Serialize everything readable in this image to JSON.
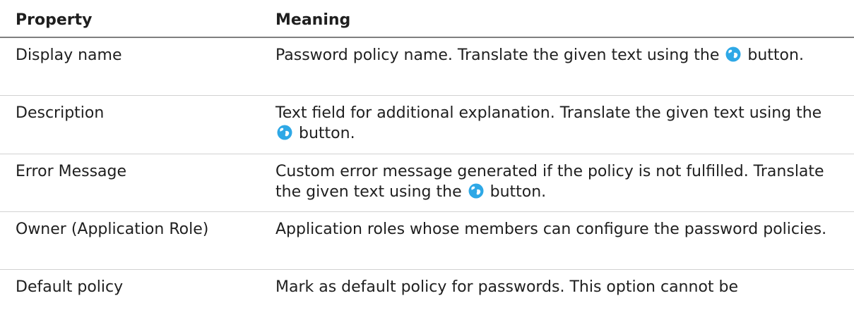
{
  "table": {
    "headers": {
      "property": "Property",
      "meaning": "Meaning"
    },
    "rows": [
      {
        "property": "Display name",
        "meaning_before": "Password policy name. Translate the given text using the",
        "meaning_after": "button."
      },
      {
        "property": "Description",
        "meaning_before": "Text field for additional explanation. Translate the given text using the",
        "meaning_after": "button."
      },
      {
        "property": "Error Message",
        "meaning_before": "Custom error message generated if the policy is not fulfilled. Translate the given text using the",
        "meaning_after": "button."
      },
      {
        "property": "Owner (Application Role)",
        "meaning": "Application roles whose members can configure the password policies."
      },
      {
        "property": "Default policy",
        "meaning": "Mark as default policy for passwords. This option cannot be"
      }
    ]
  },
  "icons": {
    "translate": "globe-translate-icon"
  },
  "colors": {
    "icon_blue": "#2ea8e6",
    "header_rule": "#7f7f7f",
    "row_rule": "#d2d2d2"
  }
}
